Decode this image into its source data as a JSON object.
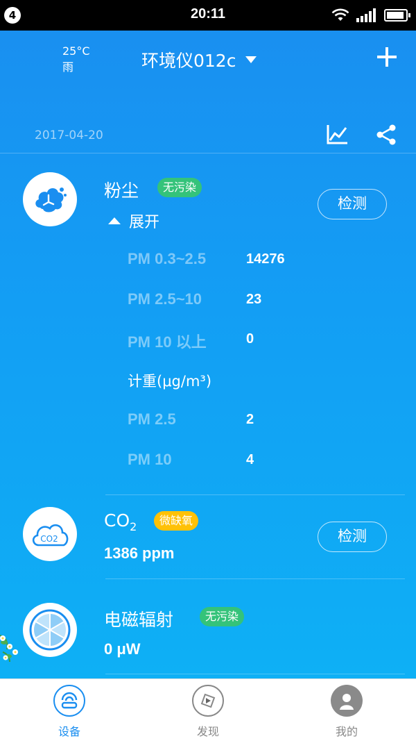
{
  "status_bar": {
    "notification_count": "4",
    "time": "20:11",
    "icons": [
      "wifi-icon",
      "signal-icon",
      "battery-icon"
    ]
  },
  "header": {
    "weather_temp": "25°C",
    "weather_desc": "雨",
    "device_name": "环境仪012c",
    "add_icon": "plus-icon",
    "date": "2017-04-20",
    "trend_icon": "line-chart-icon",
    "share_icon": "share-icon"
  },
  "dust": {
    "title": "粉尘",
    "badge": "无污染",
    "check_label": "检测",
    "expand_label": "展开",
    "counts": [
      {
        "label": "PM 0.3~2.5",
        "value": "14276"
      },
      {
        "label": "PM 2.5~10",
        "value": "23"
      },
      {
        "label": "PM 10 以上",
        "value": "0"
      }
    ],
    "weight_label": "计重(μg/m³)",
    "weights": [
      {
        "label": "PM 2.5",
        "value": "2"
      },
      {
        "label": "PM 10",
        "value": "4"
      }
    ]
  },
  "co2": {
    "title_main": "CO",
    "title_sub": "2",
    "icon_text": "CO2",
    "badge": "微缺氧",
    "check_label": "检测",
    "reading": "1386 ppm"
  },
  "emr": {
    "title": "电磁辐射",
    "badge": "无污染",
    "reading": "0 μW"
  },
  "bottom_nav": {
    "items": [
      {
        "label": "设备",
        "icon": "device-icon",
        "active": true
      },
      {
        "label": "发现",
        "icon": "compass-icon",
        "active": false
      },
      {
        "label": "我的",
        "icon": "profile-icon",
        "active": false
      }
    ]
  },
  "colors": {
    "accent": "#1a8ef0",
    "badge_green": "#34c37a",
    "badge_yellow": "#ffc107",
    "nav_active": "#1a8ef0",
    "nav_inactive": "#888888"
  }
}
